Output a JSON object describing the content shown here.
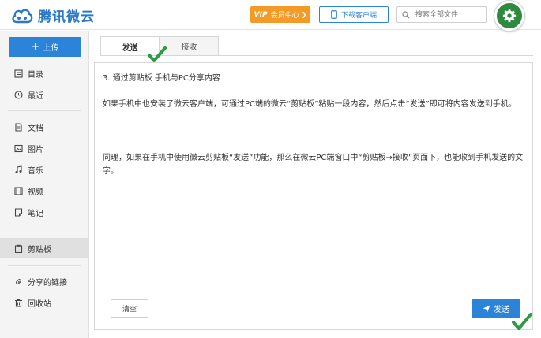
{
  "header": {
    "logo_text": "腾讯微云",
    "vip_badge": "VIP",
    "vip_label": "会员中心",
    "client_label": "下载客户端",
    "search_placeholder": "搜索全部文件"
  },
  "sidebar": {
    "upload_label": "上传",
    "items": [
      {
        "label": "目录",
        "icon": "directory-icon"
      },
      {
        "label": "最近",
        "icon": "clock-icon"
      },
      {
        "label": "文档",
        "icon": "document-icon"
      },
      {
        "label": "图片",
        "icon": "image-icon"
      },
      {
        "label": "音乐",
        "icon": "music-icon"
      },
      {
        "label": "视频",
        "icon": "video-icon"
      },
      {
        "label": "笔记",
        "icon": "note-icon"
      },
      {
        "label": "剪贴板",
        "icon": "clipboard-icon",
        "active": true
      },
      {
        "label": "分享的链接",
        "icon": "link-icon"
      },
      {
        "label": "回收站",
        "icon": "trash-icon"
      }
    ]
  },
  "tabs": [
    {
      "label": "发送",
      "active": true
    },
    {
      "label": "接收",
      "active": false
    }
  ],
  "content": {
    "heading": "3. 通过剪贴板  手机与PC分享内容",
    "paragraph1": "如果手机中也安装了微云客户端，可通过PC端的微云“剪贴板”粘贴一段内容，然后点击“发送”即可将内容发送到手机。",
    "paragraph2": "同理，如果在手机中使用微云剪贴板“发送”功能，那么在微云PC端窗口中“剪贴板→接收”页面下，也能收到手机发送的文字。"
  },
  "actions": {
    "clear_label": "清空",
    "send_label": "发送"
  },
  "colors": {
    "accent": "#2b84d8",
    "vip": "#f39a27",
    "gear_bg": "#2d8a3e",
    "check": "#2e9b44"
  }
}
